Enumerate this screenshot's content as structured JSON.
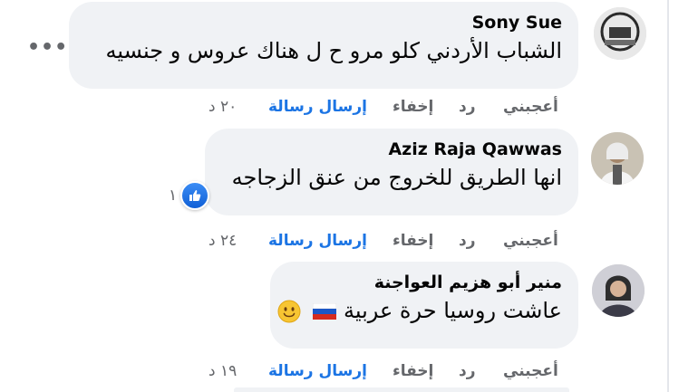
{
  "comments": [
    {
      "author": "Sony Sue",
      "text": "الشباب الأردني كلو مرو ح ل هناك عروس و جنسيه",
      "actions": {
        "like": "أعجبني",
        "reply": "رد",
        "hide": "إخفاء",
        "message": "إرسال رسالة",
        "time": "٢٠ د"
      }
    },
    {
      "author": "Aziz Raja Qawwas",
      "text": "انها الطريق للخروج من عنق الزجاجه",
      "reaction_count": "١",
      "actions": {
        "like": "أعجبني",
        "reply": "رد",
        "hide": "إخفاء",
        "message": "إرسال رسالة",
        "time": "٢٤ د"
      }
    },
    {
      "author": "منير أبو هزيم العواجنة",
      "text": "عاشت روسيا حرة عربية",
      "actions": {
        "like": "أعجبني",
        "reply": "رد",
        "hide": "إخفاء",
        "message": "إرسال رسالة",
        "time": "١٩ د"
      }
    }
  ],
  "icons": {
    "more": "more-options-icon",
    "like_reaction": "like-reaction-icon",
    "russia_flag": "russia-flag-emoji",
    "smile": "smiling-face-emoji"
  },
  "colors": {
    "bubble": "#f0f2f5",
    "link_blue": "#1b74e4",
    "meta_gray": "#65676b",
    "text": "#050505"
  }
}
